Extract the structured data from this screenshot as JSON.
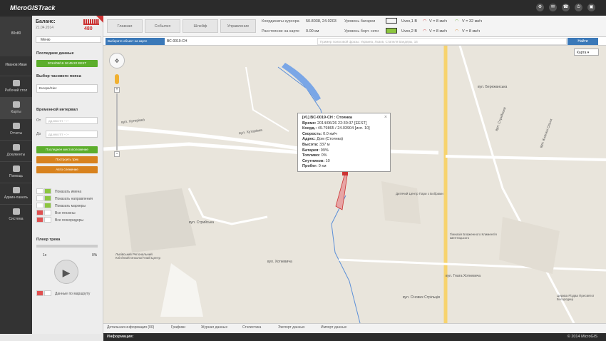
{
  "app": {
    "title": "MicroGISTrack",
    "copyright": "© 2014 MicroGIS"
  },
  "balance": {
    "label": "Баланс:",
    "date": "21.04.2014",
    "value": "480"
  },
  "menu": {
    "label": "Меню"
  },
  "user": {
    "name": "Иванов Иван",
    "avatar": "80x80"
  },
  "nav": [
    {
      "label": "Рабочий стол",
      "icon": "monitor-icon"
    },
    {
      "label": "Карты",
      "icon": "map-icon"
    },
    {
      "label": "Отчеты",
      "icon": "chart-icon"
    },
    {
      "label": "Документы",
      "icon": "document-icon"
    },
    {
      "label": "Помощь",
      "icon": "chat-icon"
    },
    {
      "label": "Админ-панель",
      "icon": "gear-icon"
    },
    {
      "label": "Система",
      "icon": "gear-icon"
    }
  ],
  "last_data": {
    "title": "Последние данные",
    "value": "2014/06/16 16:45:22 EEST"
  },
  "timezone": {
    "title": "Выбор часового пояса",
    "value": "Europe/Kiev"
  },
  "interval": {
    "title": "Временной интервал",
    "from_label": "От",
    "to_label": "До",
    "placeholder": "дд.мм.гггг  --:--"
  },
  "buttons": {
    "last_location": "Последнее местоположение",
    "build_track": "Построить трек",
    "auto_follow": "Авто слежение"
  },
  "toggles": [
    {
      "label": "Показать имена",
      "on": true
    },
    {
      "label": "Показать направления",
      "on": true
    },
    {
      "label": "Показать маркеры",
      "on": true
    },
    {
      "label": "Все геозоны",
      "on": false
    },
    {
      "label": "Все геокоридоры",
      "on": false
    }
  ],
  "player": {
    "title": "Плеер трека",
    "speed": "1x",
    "percent": "0%",
    "route_label": "Данные по маршруту"
  },
  "tabs": [
    "Главная",
    "События",
    "Шлейф",
    "Управление"
  ],
  "info": {
    "cursor_label": "Координаты курсора",
    "cursor_value": "50.8038, 24.0203",
    "dist_label": "Расстояние на карте",
    "dist_value": "0.00 км",
    "battery_label": "Уровень батареи",
    "board_label": "Уровень борт. сети",
    "uvx1": "Uvxx,1 B",
    "uvx2": "Uvxx,2 B",
    "v1": "V = 8 км/ч",
    "v2": "V = 32 км/ч",
    "v3": "V = 8 км/ч",
    "v4": "V = 8 км/ч"
  },
  "search": {
    "select_label": "Выберите объект на карте",
    "object": "ВС-0019-СН",
    "placeholder": "Пример поисковой фразы: Украина, Львов, Стапеля Бандеры, 16",
    "find": "Найти",
    "map_type": "Карта"
  },
  "popup": {
    "title": "[#1]  ВС-0019-СН : Стоянка",
    "rows": [
      [
        "Время:",
        "2014/06/26 22:30:37 [EEST]"
      ],
      [
        "Коорд.:",
        "49.79865 / 24.03904 [исп. 10]"
      ],
      [
        "Скорость:",
        "0.0 км/ч"
      ],
      [
        "Адрес:",
        "Дом (Стоянка)"
      ],
      [
        "Высота:",
        "337 м"
      ],
      [
        "Батарея:",
        "99%"
      ],
      [
        "Топливо:",
        "0%"
      ],
      [
        "Спутников:",
        "10"
      ],
      [
        "Пробег:",
        "0 км"
      ]
    ]
  },
  "bottom_tabs": [
    "Детальная информация (00)",
    "Графики",
    "Журнал данных",
    "Статистика",
    "Экспорт данных",
    "Импорт данных"
  ],
  "status": {
    "info_label": "Информация:"
  },
  "map_labels": [
    "вул. Хуторівка",
    "вул. Хуторівка",
    "вул. Стрийська",
    "вул. Хоткевича",
    "вул. Січових Стрільців",
    "вул. Гната Хоткевича",
    "вул. Стрийська",
    "Дитячий Центр Пари з Бобрами",
    "Львівський Регіональний Клінічний Онкологічний Центр",
    "Гімназія Блаженного Климентія Шептицького",
    "Церква Різдва Пресвятої Богородиці",
    "вул. Бережанська",
    "вул. Княгині Ольги"
  ]
}
